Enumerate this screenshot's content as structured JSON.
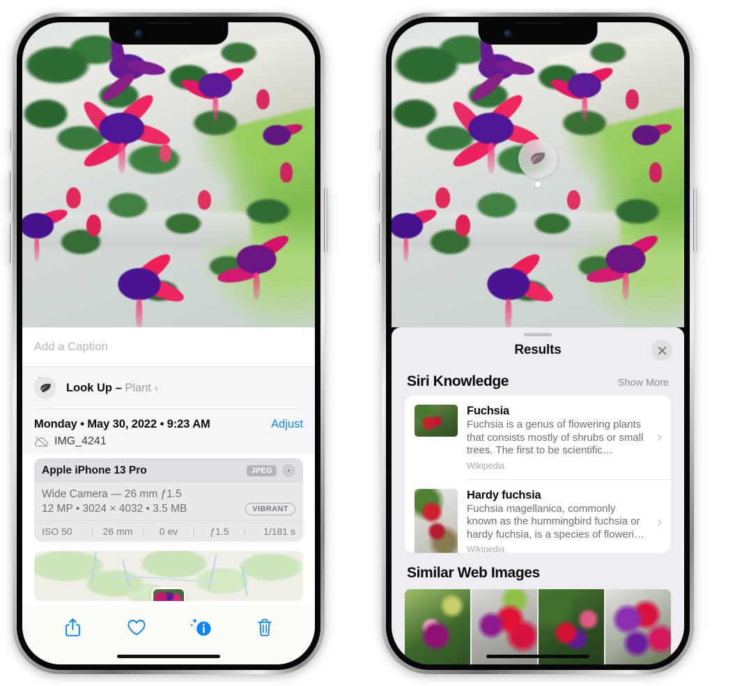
{
  "left_phone": {
    "photo": {
      "alt_name": "fuchsia-flowers-photo"
    },
    "caption_field": {
      "placeholder": "Add a Caption",
      "value": ""
    },
    "look_up": {
      "icon": "leaf-icon",
      "sparkle_icon": "sparkles-icon",
      "label": "Look Up",
      "dash": " – ",
      "subject": "Plant",
      "chevron": "›"
    },
    "metadata": {
      "date": "Monday • May 30, 2022 • 9:23 AM",
      "adjust_label": "Adjust",
      "cloud_icon": "cloud-slash-icon",
      "filename": "IMG_4241"
    },
    "exif": {
      "device": "Apple iPhone 13 Pro",
      "format_badge": "JPEG",
      "hdr_icon": "aperture-icon",
      "lens": "Wide Camera — 26 mm ƒ1.5",
      "dimensions": "12 MP • 3024 × 4032 • 3.5 MB",
      "style_badge": "VIBRANT",
      "settings": [
        "ISO 50",
        "26 mm",
        "0 ev",
        "ƒ1.5",
        "1/181 s"
      ]
    },
    "map_card": {
      "name": "location-map-card",
      "pin": "photo-pin"
    },
    "toolbar": [
      {
        "name": "share-icon",
        "label": "Share"
      },
      {
        "name": "heart-icon",
        "label": "Favorite"
      },
      {
        "name": "info-sparkle-icon",
        "label": "Info"
      },
      {
        "name": "trash-icon",
        "label": "Delete"
      }
    ],
    "accent_color": "#0a84ff"
  },
  "right_phone": {
    "photo": {
      "alt_name": "fuchsia-flowers-photo"
    },
    "lens_badge": {
      "icon": "leaf-icon",
      "name": "visual-lookup-badge"
    },
    "sheet": {
      "title": "Results",
      "close_icon": "close-icon",
      "grabber": "drag-handle"
    },
    "siri_knowledge": {
      "title": "Siri Knowledge",
      "action": "Show More",
      "items": [
        {
          "title": "Fuchsia",
          "description": "Fuchsia is a genus of flowering plants that consists mostly of shrubs or small trees. The first to be scientific…",
          "source": "Wikipedia",
          "thumb": "fuchsia-thumbnail",
          "chevron": "›"
        },
        {
          "title": "Hardy fuchsia",
          "description": "Fuchsia magellanica, commonly known as the hummingbird fuchsia or hardy fuchsia, is a species of floweri…",
          "source": "Wikipedia",
          "thumb": "hardy-fuchsia-thumbnail",
          "chevron": "›"
        }
      ]
    },
    "similar_web_images": {
      "title": "Similar Web Images",
      "items": [
        {
          "name": "web-image-1"
        },
        {
          "name": "web-image-2"
        },
        {
          "name": "web-image-3"
        },
        {
          "name": "web-image-4"
        }
      ]
    }
  }
}
